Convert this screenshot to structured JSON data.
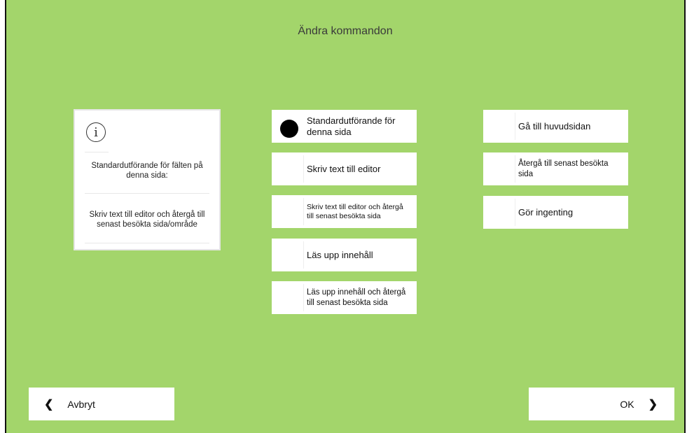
{
  "header": {
    "title": "Ändra kommandon"
  },
  "info": {
    "icon": "info-icon",
    "icon_glyph": "i",
    "heading": "Standardutförande för fälten på denna sida:",
    "description": "Skriv text till editor och återgå till senast besökta sida/område"
  },
  "middle_options": [
    {
      "label": "Standardutförande för denna sida",
      "selected": true
    },
    {
      "label": "Skriv text till editor",
      "selected": false
    },
    {
      "label": "Skriv text till editor och återgå till senast besökta sida",
      "selected": false
    },
    {
      "label": "Läs upp innehåll",
      "selected": false
    },
    {
      "label": "Läs upp innehåll och återgå till senast besökta sida",
      "selected": false
    }
  ],
  "right_options": [
    {
      "label": "Gå till huvudsidan"
    },
    {
      "label": "Återgå till senast besökta sida"
    },
    {
      "label": "Gör ingenting"
    }
  ],
  "footer": {
    "cancel_label": "Avbryt",
    "ok_label": "OK",
    "cancel_icon": "chevron-left-icon",
    "ok_icon": "chevron-right-icon"
  },
  "colors": {
    "background": "#a3d56b",
    "card": "#ffffff",
    "selected_mark": "#000000"
  }
}
